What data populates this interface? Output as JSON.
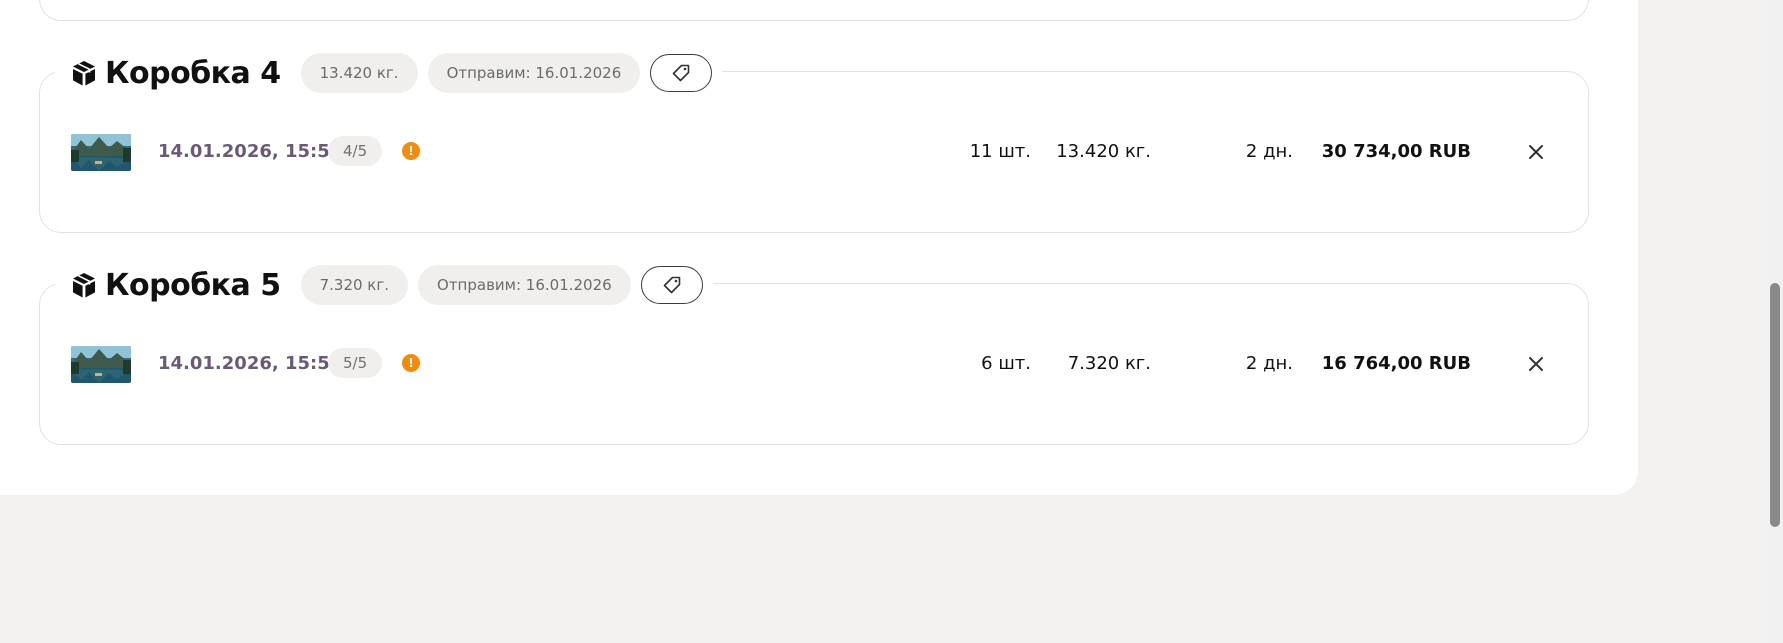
{
  "boxes": [
    {
      "title": "Коробка 4",
      "weight_pill": "13.420 кг.",
      "ship_pill": "Отправим: 16.01.2026",
      "item": {
        "thumb": "mountain-lake-photo",
        "date": "14.01.2026, 15:59",
        "position": "4/5",
        "quantity": "11 шт.",
        "weight": "13.420 кг.",
        "days": "2 дн.",
        "price": "30 734,00 RUB"
      }
    },
    {
      "title": "Коробка 5",
      "weight_pill": "7.320 кг.",
      "ship_pill": "Отправим: 16.01.2026",
      "item": {
        "thumb": "mountain-lake-photo",
        "date": "14.01.2026, 15:59",
        "position": "5/5",
        "quantity": "6 шт.",
        "weight": "7.320 кг.",
        "days": "2 дн.",
        "price": "16 764,00 RUB"
      }
    }
  ],
  "icons": {
    "box": "package-icon",
    "tag": "tag-icon",
    "warning": "warning-icon",
    "remove": "close-icon"
  },
  "colors": {
    "date_link": "#6a5a76",
    "warning": "#f38a0e",
    "pill_bg": "#f0efee",
    "page_bg": "#f3f2f0"
  },
  "scrollbar": {
    "thumb_position": 0.71,
    "thumb_size": 0.38
  }
}
